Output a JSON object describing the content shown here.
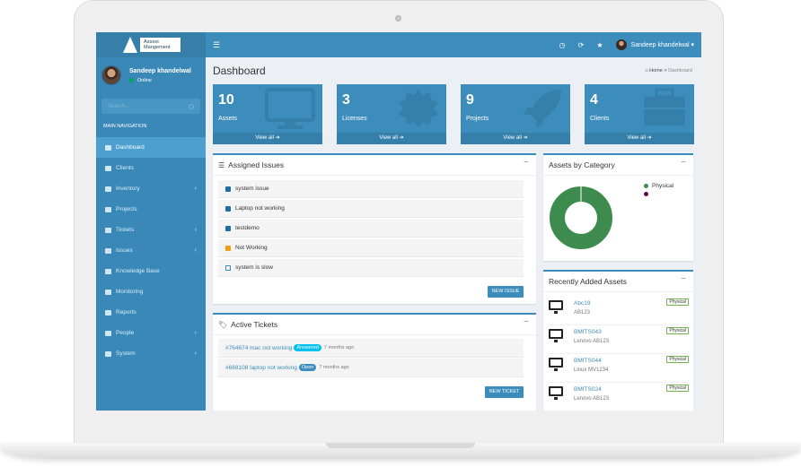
{
  "app": {
    "logo_line1": "Assest",
    "logo_line2": "Mangement"
  },
  "user": {
    "name": "Sandeep khandelwal",
    "status": "Online"
  },
  "sidebar": {
    "search_placeholder": "Search...",
    "nav_header": "MAIN NAVIGATION",
    "items": [
      {
        "label": "Dashboard",
        "active": true,
        "has_children": false
      },
      {
        "label": "Clients",
        "active": false,
        "has_children": false
      },
      {
        "label": "Inventory",
        "active": false,
        "has_children": true
      },
      {
        "label": "Projects",
        "active": false,
        "has_children": false
      },
      {
        "label": "Tickets",
        "active": false,
        "has_children": true
      },
      {
        "label": "Issues",
        "active": false,
        "has_children": true
      },
      {
        "label": "Knowledge Base",
        "active": false,
        "has_children": false
      },
      {
        "label": "Monitoring",
        "active": false,
        "has_children": false
      },
      {
        "label": "Reports",
        "active": false,
        "has_children": false
      },
      {
        "label": "People",
        "active": false,
        "has_children": true
      },
      {
        "label": "System",
        "active": false,
        "has_children": true
      }
    ]
  },
  "topbar": {
    "user_name": "Sandeep khandelwal"
  },
  "page": {
    "title": "Dashboard",
    "breadcrumb_home": "Home",
    "breadcrumb_sep": ">",
    "breadcrumb_current": "Dashboard"
  },
  "tiles": [
    {
      "value": "10",
      "label": "Assets",
      "footer": "View all",
      "icon": "monitor-icon"
    },
    {
      "value": "3",
      "label": "Licenses",
      "footer": "View all",
      "icon": "certificate-icon"
    },
    {
      "value": "9",
      "label": "Projects",
      "footer": "View all",
      "icon": "rocket-icon"
    },
    {
      "value": "4",
      "label": "Clients",
      "footer": "View all",
      "icon": "briefcase-icon"
    }
  ],
  "assigned_issues": {
    "title": "Assigned Issues",
    "items": [
      {
        "label": "system issue",
        "state": "checked"
      },
      {
        "label": "Laptop not working",
        "state": "checked"
      },
      {
        "label": "testdemo",
        "state": "checked"
      },
      {
        "label": "Not Working",
        "state": "warning"
      },
      {
        "label": "system is slow",
        "state": "external-link"
      }
    ],
    "button": "NEW ISSUE"
  },
  "active_tickets": {
    "title": "Active Tickets",
    "items": [
      {
        "id": "#764674",
        "subject": "mac not working",
        "badge": "Answered",
        "badge_color": "#00c0ef",
        "ago": "7 months ago"
      },
      {
        "id": "#668108",
        "subject": "laptop not working",
        "badge": "Open",
        "badge_color": "#3c8dbc",
        "ago": "7 months ago"
      }
    ],
    "button": "NEW TICKET"
  },
  "assets_by_category": {
    "title": "Assets by Category",
    "legend": [
      {
        "name": "Physical",
        "color": "#3d8b4f"
      },
      {
        "name": "",
        "color": "#5c0a4a"
      }
    ]
  },
  "chart_data": {
    "type": "pie",
    "title": "Assets by Category",
    "labels": [
      "Physical",
      ""
    ],
    "values": [
      100,
      0
    ],
    "colors": [
      "#3d8b4f",
      "#5c0a4a"
    ],
    "legend": "top-right"
  },
  "recent_assets": {
    "title": "Recently Added Assets",
    "items": [
      {
        "name": "Abc19",
        "model": "AB123",
        "type": "Physical"
      },
      {
        "name": "BMITS043",
        "model": "Lenovo AB123",
        "type": "Physical"
      },
      {
        "name": "BMITS044",
        "model": "Linux MV1234",
        "type": "Physical"
      },
      {
        "name": "BMITS024",
        "model": "Lenovo AB123",
        "type": "Physical"
      }
    ]
  },
  "colors": {
    "primary": "#3c8dbc",
    "sidebar": "#3a88b8",
    "success": "#00a65a"
  }
}
